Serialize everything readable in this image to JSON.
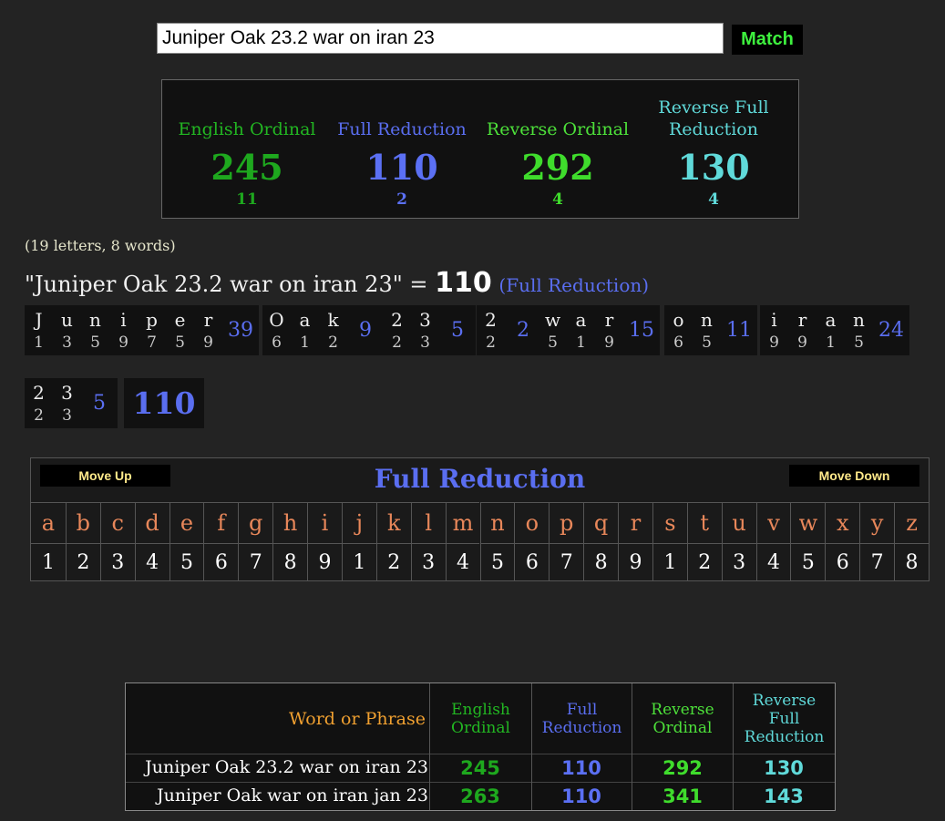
{
  "search": {
    "value": "Juniper Oak 23.2 war on iran 23",
    "button_label": "Match"
  },
  "summary": [
    {
      "name": "English Ordinal",
      "value": "245",
      "sub": "11",
      "color": "#22b622"
    },
    {
      "name": "Full Reduction",
      "value": "110",
      "sub": "2",
      "color": "#5a6ef0"
    },
    {
      "name": "Reverse Ordinal",
      "value": "292",
      "sub": "4",
      "color": "#4de03a"
    },
    {
      "name": "Reverse Full Reduction",
      "value": "130",
      "sub": "4",
      "color": "#5fd8d8"
    }
  ],
  "counts": "(19 letters, 8 words)",
  "phrase_line": {
    "phrase": "\"Juniper Oak 23.2 war on iran 23\" =",
    "total": "110",
    "cipher": "(Full Reduction)"
  },
  "breakdown": {
    "words": [
      {
        "letters": [
          "J",
          "u",
          "n",
          "i",
          "p",
          "e",
          "r"
        ],
        "numbers": [
          "1",
          "3",
          "5",
          "9",
          "7",
          "5",
          "9"
        ],
        "sum": "39"
      },
      {
        "letters": [
          "O",
          "a",
          "k"
        ],
        "numbers": [
          "6",
          "1",
          "2"
        ],
        "sum": "9"
      },
      {
        "letters": [
          "2",
          "3"
        ],
        "numbers": [
          "2",
          "3"
        ],
        "sum": "5"
      },
      {
        "letters": [
          "2"
        ],
        "numbers": [
          "2"
        ],
        "sum": "2"
      },
      {
        "letters": [
          "w",
          "a",
          "r"
        ],
        "numbers": [
          "5",
          "1",
          "9"
        ],
        "sum": "15"
      },
      {
        "letters": [
          "o",
          "n"
        ],
        "numbers": [
          "6",
          "5"
        ],
        "sum": "11"
      },
      {
        "letters": [
          "i",
          "r",
          "a",
          "n"
        ],
        "numbers": [
          "9",
          "9",
          "1",
          "5"
        ],
        "sum": "24"
      },
      {
        "letters": [
          "2",
          "3"
        ],
        "numbers": [
          "2",
          "3"
        ],
        "sum": "5"
      }
    ],
    "total": "110"
  },
  "cipher_table": {
    "title": "Full Reduction",
    "move_up": "Move Up",
    "move_down": "Move Down",
    "letters": [
      "a",
      "b",
      "c",
      "d",
      "e",
      "f",
      "g",
      "h",
      "i",
      "j",
      "k",
      "l",
      "m",
      "n",
      "o",
      "p",
      "q",
      "r",
      "s",
      "t",
      "u",
      "v",
      "w",
      "x",
      "y",
      "z"
    ],
    "numbers": [
      "1",
      "2",
      "3",
      "4",
      "5",
      "6",
      "7",
      "8",
      "9",
      "1",
      "2",
      "3",
      "4",
      "5",
      "6",
      "7",
      "8",
      "9",
      "1",
      "2",
      "3",
      "4",
      "5",
      "6",
      "7",
      "8"
    ]
  },
  "results": {
    "header": {
      "phrase": "Word or Phrase",
      "eo": "English Ordinal",
      "fr": "Full Reduction",
      "ro": "Reverse Ordinal",
      "rf": "Reverse Full Reduction"
    },
    "rows": [
      {
        "phrase": "Juniper Oak 23.2 war on iran 23",
        "eo": "245",
        "fr": "110",
        "ro": "292",
        "rf": "130"
      },
      {
        "phrase": "Juniper Oak war on iran jan 23",
        "eo": "263",
        "fr": "110",
        "ro": "341",
        "rf": "143"
      }
    ]
  }
}
